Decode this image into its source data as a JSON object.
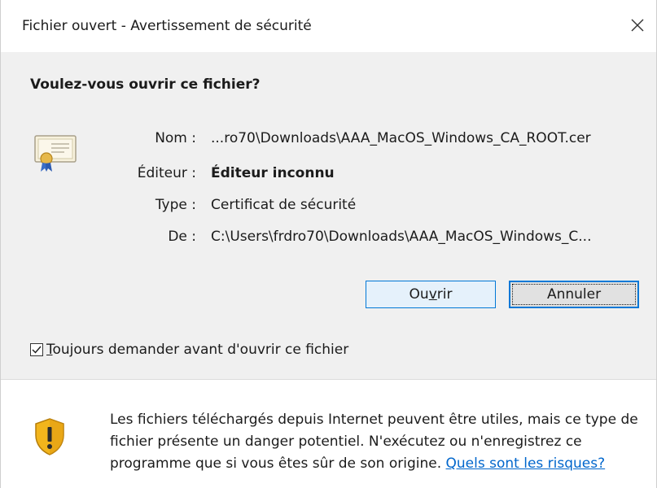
{
  "window": {
    "title": "Fichier ouvert - Avertissement de sécurité",
    "close_symbol": "✕"
  },
  "dialog": {
    "heading": "Voulez-vous ouvrir ce fichier?",
    "icon": "certificate-icon",
    "fields": {
      "name": {
        "label": "Nom :",
        "value": "...ro70\\Downloads\\AAA_MacOS_Windows_CA_ROOT.cer"
      },
      "publisher": {
        "label": "Éditeur :",
        "value": "Éditeur inconnu"
      },
      "type": {
        "label": "Type :",
        "value": "Certificat de sécurité"
      },
      "from": {
        "label": "De :",
        "value": "C:\\Users\\frdro70\\Downloads\\AAA_MacOS_Windows_C..."
      }
    }
  },
  "buttons": {
    "open": {
      "label_pre": "Ou",
      "label_access": "v",
      "label_post": "rir"
    },
    "cancel": {
      "label": "Annuler"
    }
  },
  "checkbox": {
    "checked": true,
    "label_access": "T",
    "label_rest": "oujours demander avant d'ouvrir ce fichier"
  },
  "footer": {
    "icon": "warning-shield-icon",
    "text": "Les fichiers téléchargés depuis Internet peuvent être utiles, mais ce type de fichier présente un danger potentiel. N'exécutez ou n'enregistrez ce programme que si vous êtes sûr de son origine. ",
    "link": "Quels sont les risques?"
  },
  "colors": {
    "accent": "#0078d7",
    "content_bg": "#f0f0f0",
    "link": "#0066cc"
  }
}
